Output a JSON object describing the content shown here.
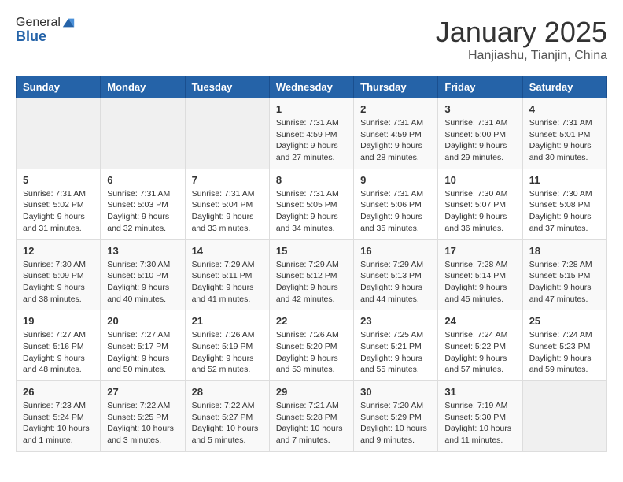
{
  "header": {
    "logo_line1": "General",
    "logo_line2": "Blue",
    "month": "January 2025",
    "location": "Hanjiashu, Tianjin, China"
  },
  "weekdays": [
    "Sunday",
    "Monday",
    "Tuesday",
    "Wednesday",
    "Thursday",
    "Friday",
    "Saturday"
  ],
  "weeks": [
    [
      {
        "day": "",
        "info": ""
      },
      {
        "day": "",
        "info": ""
      },
      {
        "day": "",
        "info": ""
      },
      {
        "day": "1",
        "info": "Sunrise: 7:31 AM\nSunset: 4:59 PM\nDaylight: 9 hours\nand 27 minutes."
      },
      {
        "day": "2",
        "info": "Sunrise: 7:31 AM\nSunset: 4:59 PM\nDaylight: 9 hours\nand 28 minutes."
      },
      {
        "day": "3",
        "info": "Sunrise: 7:31 AM\nSunset: 5:00 PM\nDaylight: 9 hours\nand 29 minutes."
      },
      {
        "day": "4",
        "info": "Sunrise: 7:31 AM\nSunset: 5:01 PM\nDaylight: 9 hours\nand 30 minutes."
      }
    ],
    [
      {
        "day": "5",
        "info": "Sunrise: 7:31 AM\nSunset: 5:02 PM\nDaylight: 9 hours\nand 31 minutes."
      },
      {
        "day": "6",
        "info": "Sunrise: 7:31 AM\nSunset: 5:03 PM\nDaylight: 9 hours\nand 32 minutes."
      },
      {
        "day": "7",
        "info": "Sunrise: 7:31 AM\nSunset: 5:04 PM\nDaylight: 9 hours\nand 33 minutes."
      },
      {
        "day": "8",
        "info": "Sunrise: 7:31 AM\nSunset: 5:05 PM\nDaylight: 9 hours\nand 34 minutes."
      },
      {
        "day": "9",
        "info": "Sunrise: 7:31 AM\nSunset: 5:06 PM\nDaylight: 9 hours\nand 35 minutes."
      },
      {
        "day": "10",
        "info": "Sunrise: 7:30 AM\nSunset: 5:07 PM\nDaylight: 9 hours\nand 36 minutes."
      },
      {
        "day": "11",
        "info": "Sunrise: 7:30 AM\nSunset: 5:08 PM\nDaylight: 9 hours\nand 37 minutes."
      }
    ],
    [
      {
        "day": "12",
        "info": "Sunrise: 7:30 AM\nSunset: 5:09 PM\nDaylight: 9 hours\nand 38 minutes."
      },
      {
        "day": "13",
        "info": "Sunrise: 7:30 AM\nSunset: 5:10 PM\nDaylight: 9 hours\nand 40 minutes."
      },
      {
        "day": "14",
        "info": "Sunrise: 7:29 AM\nSunset: 5:11 PM\nDaylight: 9 hours\nand 41 minutes."
      },
      {
        "day": "15",
        "info": "Sunrise: 7:29 AM\nSunset: 5:12 PM\nDaylight: 9 hours\nand 42 minutes."
      },
      {
        "day": "16",
        "info": "Sunrise: 7:29 AM\nSunset: 5:13 PM\nDaylight: 9 hours\nand 44 minutes."
      },
      {
        "day": "17",
        "info": "Sunrise: 7:28 AM\nSunset: 5:14 PM\nDaylight: 9 hours\nand 45 minutes."
      },
      {
        "day": "18",
        "info": "Sunrise: 7:28 AM\nSunset: 5:15 PM\nDaylight: 9 hours\nand 47 minutes."
      }
    ],
    [
      {
        "day": "19",
        "info": "Sunrise: 7:27 AM\nSunset: 5:16 PM\nDaylight: 9 hours\nand 48 minutes."
      },
      {
        "day": "20",
        "info": "Sunrise: 7:27 AM\nSunset: 5:17 PM\nDaylight: 9 hours\nand 50 minutes."
      },
      {
        "day": "21",
        "info": "Sunrise: 7:26 AM\nSunset: 5:19 PM\nDaylight: 9 hours\nand 52 minutes."
      },
      {
        "day": "22",
        "info": "Sunrise: 7:26 AM\nSunset: 5:20 PM\nDaylight: 9 hours\nand 53 minutes."
      },
      {
        "day": "23",
        "info": "Sunrise: 7:25 AM\nSunset: 5:21 PM\nDaylight: 9 hours\nand 55 minutes."
      },
      {
        "day": "24",
        "info": "Sunrise: 7:24 AM\nSunset: 5:22 PM\nDaylight: 9 hours\nand 57 minutes."
      },
      {
        "day": "25",
        "info": "Sunrise: 7:24 AM\nSunset: 5:23 PM\nDaylight: 9 hours\nand 59 minutes."
      }
    ],
    [
      {
        "day": "26",
        "info": "Sunrise: 7:23 AM\nSunset: 5:24 PM\nDaylight: 10 hours\nand 1 minute."
      },
      {
        "day": "27",
        "info": "Sunrise: 7:22 AM\nSunset: 5:25 PM\nDaylight: 10 hours\nand 3 minutes."
      },
      {
        "day": "28",
        "info": "Sunrise: 7:22 AM\nSunset: 5:27 PM\nDaylight: 10 hours\nand 5 minutes."
      },
      {
        "day": "29",
        "info": "Sunrise: 7:21 AM\nSunset: 5:28 PM\nDaylight: 10 hours\nand 7 minutes."
      },
      {
        "day": "30",
        "info": "Sunrise: 7:20 AM\nSunset: 5:29 PM\nDaylight: 10 hours\nand 9 minutes."
      },
      {
        "day": "31",
        "info": "Sunrise: 7:19 AM\nSunset: 5:30 PM\nDaylight: 10 hours\nand 11 minutes."
      },
      {
        "day": "",
        "info": ""
      }
    ]
  ]
}
